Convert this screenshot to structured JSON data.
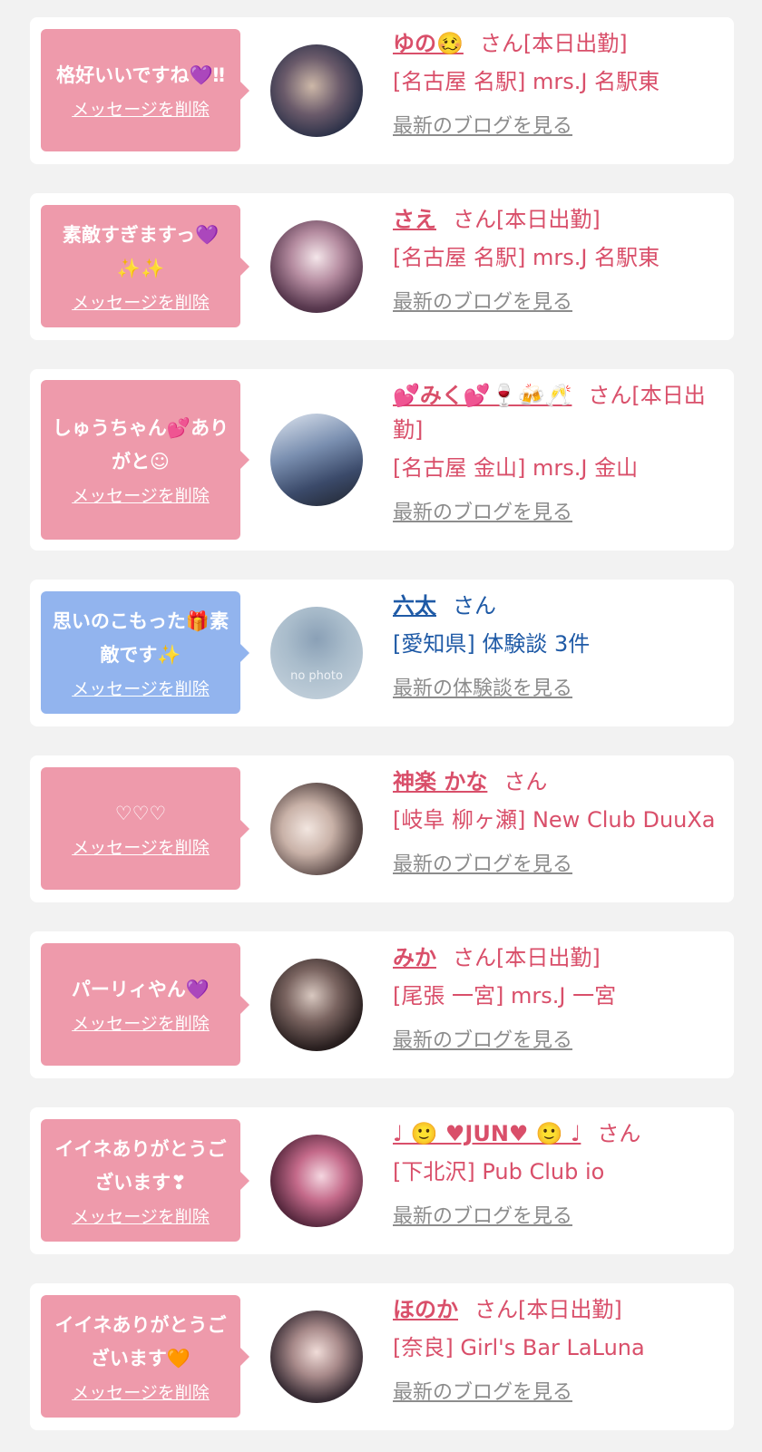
{
  "common": {
    "delete_label": "メッセージを削除",
    "san_suffix": "さん",
    "on_duty_suffix": "さん[本日出勤]"
  },
  "items": [
    {
      "message": "格好いいですね💜‼",
      "name": "ゆの🥴",
      "name_suffix": "さん[本日出勤]",
      "venue": "[名古屋 名駅] mrs.J 名駅東",
      "link": "最新のブログを見る",
      "bubble_color": "#ee9aab",
      "text_color": "#d94f6a",
      "avatar_icon": "avatar-photo"
    },
    {
      "message": "素敵すぎますっ💜✨✨",
      "name": "さえ",
      "name_suffix": "さん[本日出勤]",
      "venue": "[名古屋 名駅] mrs.J 名駅東",
      "link": "最新のブログを見る",
      "bubble_color": "#ee9aab",
      "text_color": "#d94f6a",
      "avatar_icon": "avatar-photo"
    },
    {
      "message": "しゅうちゃん💕ありがと☺",
      "name": "💕みく💕🍷🍻🥂",
      "name_suffix": "さん[本日出勤]",
      "venue": "[名古屋 金山] mrs.J 金山",
      "link": "最新のブログを見る",
      "bubble_color": "#ee9aab",
      "text_color": "#d94f6a",
      "avatar_icon": "avatar-photo"
    },
    {
      "message": "思いのこもった🎁素敵です✨",
      "name": "六太",
      "name_suffix": "さん",
      "venue": "[愛知県] 体験談 3件",
      "link": "最新の体験談を見る",
      "bubble_color": "#92b4ee",
      "text_color": "#1f5aa6",
      "avatar_icon": "no-photo-avatar",
      "avatar_text": "no photo"
    },
    {
      "message": "♡♡♡",
      "name": "神楽 かな",
      "name_suffix": "さん",
      "venue": "[岐阜 柳ヶ瀬] New Club DuuXa",
      "link": "最新のブログを見る",
      "bubble_color": "#ee9aab",
      "text_color": "#d94f6a",
      "avatar_icon": "avatar-photo"
    },
    {
      "message": "パーリィやん💜",
      "name": "みか",
      "name_suffix": "さん[本日出勤]",
      "venue": "[尾張 一宮] mrs.J 一宮",
      "link": "最新のブログを見る",
      "bubble_color": "#ee9aab",
      "text_color": "#d94f6a",
      "avatar_icon": "avatar-photo"
    },
    {
      "message": "イイネありがとうございます❣",
      "name": "♩ 🙂 ♥JUN♥ 🙂 ♩",
      "name_suffix": "さん",
      "venue": "[下北沢] Pub Club io",
      "link": "最新のブログを見る",
      "bubble_color": "#ee9aab",
      "text_color": "#d94f6a",
      "avatar_icon": "avatar-photo"
    },
    {
      "message": "イイネありがとうございます🧡",
      "name": "ほのか",
      "name_suffix": "さん[本日出勤]",
      "venue": "[奈良] Girl's Bar LaLuna",
      "link": "最新のブログを見る",
      "bubble_color": "#ee9aab",
      "text_color": "#d94f6a",
      "avatar_icon": "avatar-photo"
    }
  ]
}
